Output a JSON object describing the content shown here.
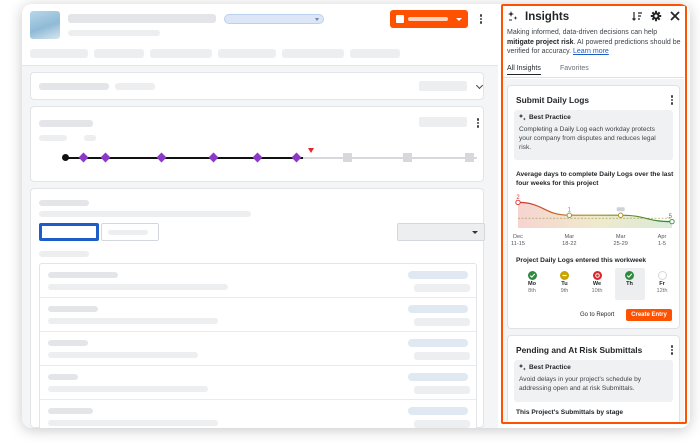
{
  "insights": {
    "title": "Insights",
    "description_prefix": "Making informed, data-driven decisions can help ",
    "description_bold": "mitigate project risk",
    "description_suffix": ". AI powered predictions should be verified for accuracy. ",
    "learn_more": "Learn more",
    "tabs": [
      {
        "label": "All Insights",
        "active": true
      },
      {
        "label": "Favorites",
        "active": false
      }
    ],
    "icons": [
      "sparkle-icon",
      "sort-icon",
      "gear-icon",
      "close-icon"
    ],
    "accent_color": "#ff5200"
  },
  "daily_logs_card": {
    "title": "Submit Daily Logs",
    "best_practice_label": "Best Practice",
    "best_practice_text": "Completing a Daily Log each workday protects your company from disputes and reduces legal risk.",
    "chart_title": "Average days to complete Daily Logs over the last four weeks for this project",
    "entered_title": "Project Daily Logs entered this workweek",
    "go_to_report": "Go to Report",
    "create_entry": "Create Entry"
  },
  "chart_data": {
    "type": "line",
    "title": "Average days to complete Daily Logs over the last four weeks for this project",
    "categories": [
      "Dec 11-15",
      "Mar 18-22",
      "Mar 25-29",
      "Apr 1-5"
    ],
    "x_labels": [
      [
        "Dec",
        "11-15"
      ],
      [
        "Mar",
        "18-22"
      ],
      [
        "Mar",
        "25-29"
      ],
      [
        "Apr",
        "1-5"
      ]
    ],
    "series": [
      {
        "values": [
          2,
          1,
          1,
          0.5
        ]
      }
    ],
    "point_labels": [
      "2",
      "1",
      "",
      ".5"
    ],
    "ylim": [
      0,
      2.5
    ],
    "grid": false,
    "colors": {
      "high": "#d9302e",
      "mid": "#a98e1f",
      "low": "#2f8a3c"
    }
  },
  "workweek": [
    {
      "name": "Mo",
      "date": "8th",
      "status": "done",
      "selected": false
    },
    {
      "name": "Tu",
      "date": "9th",
      "status": "partial",
      "selected": false
    },
    {
      "name": "We",
      "date": "10th",
      "status": "missed",
      "selected": false
    },
    {
      "name": "Th",
      "date": "",
      "status": "done",
      "selected": true
    },
    {
      "name": "Fr",
      "date": "12th",
      "status": "future",
      "selected": false
    }
  ],
  "status_colors": {
    "done": "#2e8b3d",
    "partial": "#c9a300",
    "missed": "#d9262c",
    "future": "#ffffff"
  },
  "submittals_card": {
    "title": "Pending and At Risk Submittals",
    "best_practice_label": "Best Practice",
    "best_practice_text": "Avoid delays in your project's schedule by addressing open and at risk Submittals.",
    "stage_title": "This Project's Submittals by stage"
  },
  "milestones": {
    "completed_diamonds": 7,
    "remaining_steps": 4,
    "line_color": "#111111",
    "diamond_color": "#8c39c9",
    "flag_color": "#e8242b"
  }
}
